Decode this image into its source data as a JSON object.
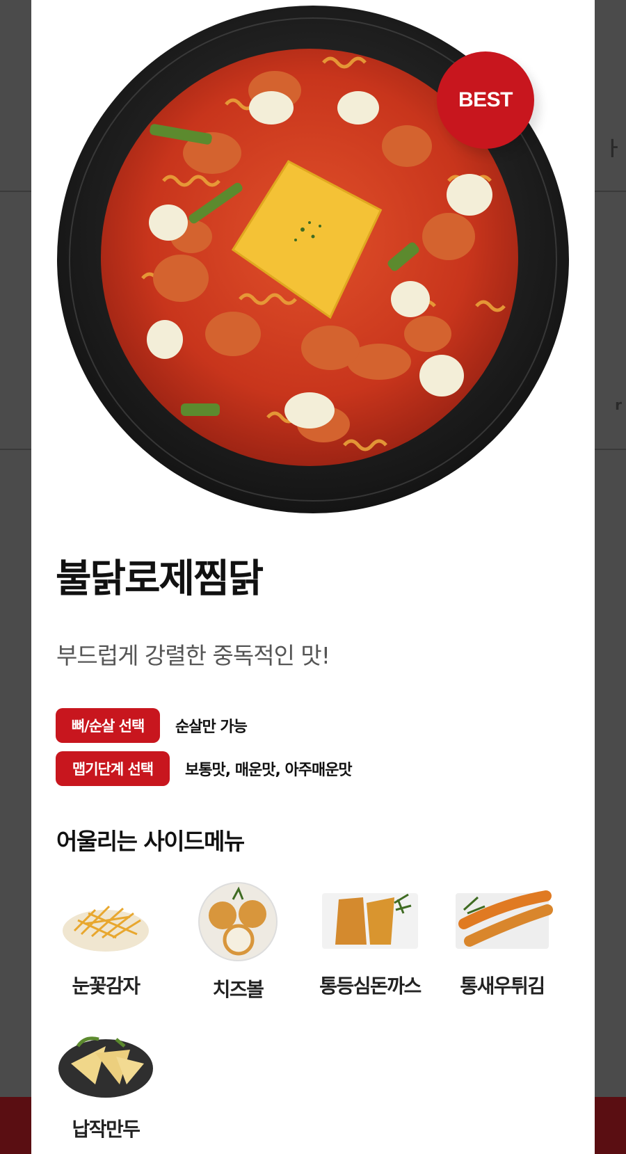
{
  "badge": {
    "label": "BEST"
  },
  "product": {
    "name": "불닭로제찜닭",
    "tagline": "부드럽게 강렬한 중독적인 맛!"
  },
  "options": [
    {
      "label": "뼈/순살 선택",
      "value": "순살만 가능"
    },
    {
      "label": "맵기단계 선택",
      "value": "보통맛, 매운맛, 아주매운맛"
    }
  ],
  "side_menu": {
    "title": "어울리는 사이드메뉴",
    "items": [
      {
        "name": "눈꽃감자",
        "icon": "fries-icon"
      },
      {
        "name": "치즈볼",
        "icon": "cheese-ball-icon"
      },
      {
        "name": "통등심돈까스",
        "icon": "pork-cutlet-icon"
      },
      {
        "name": "통새우튀김",
        "icon": "fried-shrimp-icon"
      },
      {
        "name": "납작만두",
        "icon": "dumpling-icon"
      }
    ]
  },
  "colors": {
    "accent": "#c8161e",
    "overlay": "#4b4b4b"
  }
}
